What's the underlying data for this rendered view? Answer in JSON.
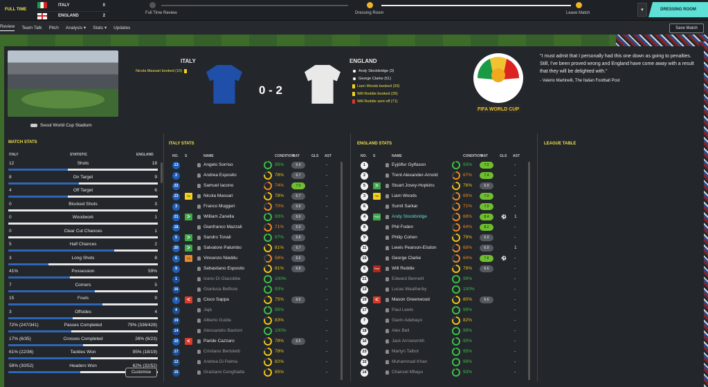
{
  "header": {
    "full_time": "FULL TIME",
    "home": {
      "name": "ITALY",
      "score": "0"
    },
    "away": {
      "name": "ENGLAND",
      "score": "2"
    },
    "timeline": [
      "Full Time Review",
      "Dressing Room",
      "Leave Match"
    ],
    "dressing_room": "DRESSING ROOM",
    "dropdown_icon": "chevron-down-icon"
  },
  "nav": {
    "tabs": [
      "Review",
      "Team Talk",
      "Pitch",
      "Analysis ▾",
      "Stats ▾",
      "Updates"
    ],
    "save": "Save Match"
  },
  "match": {
    "stadium": "Seoul World Cup Stadium",
    "home": "ITALY",
    "away": "ENGLAND",
    "score": "0 - 2",
    "home_events": [
      {
        "text": "Nicola Massari booked (10)",
        "icon": "yellow-card"
      }
    ],
    "away_events": [
      {
        "text": "Andy Stockbridge (3)",
        "icon": "ball"
      },
      {
        "text": "George Clarke (51)",
        "icon": "ball"
      },
      {
        "text": "Liam Woods booked (20)",
        "icon": "yellow-card"
      },
      {
        "text": "Will Reddie booked (26)",
        "icon": "yellow-card"
      },
      {
        "text": "Will Reddie sent off (71)",
        "icon": "red-card"
      }
    ],
    "logo_text": "FIFA WORLD CUP",
    "quote": "\"I must admit that I personally had this one down as going to penalties. Still, I've been proved wrong and England have come away with a result that they will be delighted with.\"",
    "quote_author": "- Valerio Martinelli, The Italian Football Post"
  },
  "colors": {
    "home_shirt": "#1f4fa8",
    "away_shirt": "#eeeeee",
    "accent": "#f0e04a",
    "teal": "#5fe0d6"
  },
  "match_stats": {
    "title": "MATCH STATS",
    "headers": [
      "ITALY",
      "STATISTIC",
      "ENGLAND"
    ],
    "rows": [
      {
        "l": "12",
        "s": "Shots",
        "r": "18",
        "share": 0.4
      },
      {
        "l": "8",
        "s": "On Target",
        "r": "9",
        "share": 0.47
      },
      {
        "l": "4",
        "s": "Off Target",
        "r": "6",
        "share": 0.4
      },
      {
        "l": "0",
        "s": "Blocked Shots",
        "r": "3",
        "share": 0.0
      },
      {
        "l": "0",
        "s": "Woodwork",
        "r": "1",
        "share": 0.0
      },
      {
        "l": "0",
        "s": "Clear Cut Chances",
        "r": "1",
        "share": 0.0
      },
      {
        "l": "5",
        "s": "Half Chances",
        "r": "2",
        "share": 0.71
      },
      {
        "l": "3",
        "s": "Long Shots",
        "r": "8",
        "share": 0.27
      },
      {
        "l": "41%",
        "s": "Possession",
        "r": "59%",
        "share": 0.41
      },
      {
        "l": "7",
        "s": "Corners",
        "r": "5",
        "share": 0.58
      },
      {
        "l": "15",
        "s": "Fouls",
        "r": "9",
        "share": 0.63
      },
      {
        "l": "3",
        "s": "Offsides",
        "r": "4",
        "share": 0.43
      },
      {
        "l": "72% (247/341)",
        "s": "Passes Completed",
        "r": "79% (336/428)",
        "share": 0.42
      },
      {
        "l": "17% (6/35)",
        "s": "Crosses Completed",
        "r": "26% (6/23)",
        "share": 0.5
      },
      {
        "l": "61% (22/36)",
        "s": "Tackles Won",
        "r": "95% (18/19)",
        "share": 0.55
      },
      {
        "l": "58% (30/52)",
        "s": "Headers Won",
        "r": "62% (32/52)",
        "share": 0.48
      }
    ],
    "customise": "Customise"
  },
  "player_headers": [
    "NO.",
    "S",
    "NAME",
    "CONDITION",
    "RAT",
    "GLS",
    "AST"
  ],
  "italy": {
    "title": "ITALY STATS",
    "players": [
      {
        "no": "13",
        "s": "",
        "name": "Angelo Sorriso",
        "cond": "95%",
        "rat": "6.9",
        "gls": "",
        "ast": "-",
        "pct": 95
      },
      {
        "no": "2",
        "s": "",
        "name": "Andrea Esposito",
        "cond": "78%",
        "rat": "6.7",
        "gls": "",
        "ast": "-",
        "pct": 78
      },
      {
        "no": "22",
        "s": "",
        "name": "Samuel Iacono",
        "cond": "74%",
        "rat": "7.0",
        "gls": "",
        "ast": "-",
        "pct": 74
      },
      {
        "no": "23",
        "s": "Yel",
        "name": "Nicola Massari",
        "cond": "78%",
        "rat": "6.7",
        "gls": "",
        "ast": "-",
        "pct": 78
      },
      {
        "no": "3",
        "s": "",
        "name": "Franco Muggeri",
        "cond": "70%",
        "rat": "6.8",
        "gls": "",
        "ast": "-",
        "pct": 70
      },
      {
        "no": "21",
        "s": "in",
        "name": "William Zanella",
        "cond": "93%",
        "rat": "6.6",
        "gls": "",
        "ast": "-",
        "pct": 93
      },
      {
        "no": "18",
        "s": "",
        "name": "Gianfranco Mazzali",
        "cond": "71%",
        "rat": "6.9",
        "gls": "",
        "ast": "-",
        "pct": 71
      },
      {
        "no": "5",
        "s": "in",
        "name": "Sandro Tonali",
        "cond": "97%",
        "rat": "6.8",
        "gls": "",
        "ast": "-",
        "pct": 97
      },
      {
        "no": "20",
        "s": "in",
        "name": "Salvatore Palumbo",
        "cond": "81%",
        "rat": "6.7",
        "gls": "",
        "ast": "-",
        "pct": 81
      },
      {
        "no": "6",
        "s": "Inj",
        "name": "Vincenzo Nieddu",
        "cond": "58%",
        "rat": "6.5",
        "gls": "",
        "ast": "-",
        "pct": 58
      },
      {
        "no": "9",
        "s": "",
        "name": "Sebastiano Esposito",
        "cond": "81%",
        "rat": "6.8",
        "gls": "",
        "ast": "-",
        "pct": 81
      },
      {
        "no": "1",
        "s": "",
        "name": "Ivano Di Giacobbe",
        "cond": "100%",
        "rat": "",
        "gls": "",
        "ast": "-",
        "pct": 100
      },
      {
        "no": "16",
        "s": "",
        "name": "Gianluca Belfiore",
        "cond": "93%",
        "rat": "",
        "gls": "",
        "ast": "-",
        "pct": 93
      },
      {
        "no": "7",
        "s": "out",
        "name": "Cisco Sappa",
        "cond": "75%",
        "rat": "6.6",
        "gls": "",
        "ast": "-",
        "pct": 75
      },
      {
        "no": "4",
        "s": "",
        "name": "Jajá",
        "cond": "95%",
        "rat": "",
        "gls": "",
        "ast": "-",
        "pct": 95
      },
      {
        "no": "19",
        "s": "",
        "name": "Alberto Guida",
        "cond": "83%",
        "rat": "",
        "gls": "",
        "ast": "-",
        "pct": 83
      },
      {
        "no": "14",
        "s": "",
        "name": "Alessandro Bastoni",
        "cond": "100%",
        "rat": "",
        "gls": "",
        "ast": "-",
        "pct": 100
      },
      {
        "no": "10",
        "s": "out",
        "name": "Paride Cazzaro",
        "cond": "78%",
        "rat": "6.5",
        "gls": "",
        "ast": "-",
        "pct": 78
      },
      {
        "no": "17",
        "s": "",
        "name": "Cristiano Bertoletti",
        "cond": "78%",
        "rat": "",
        "gls": "",
        "ast": "-",
        "pct": 78
      },
      {
        "no": "12",
        "s": "",
        "name": "Andrea Di Palma",
        "cond": "82%",
        "rat": "",
        "gls": "",
        "ast": "-",
        "pct": 82
      },
      {
        "no": "15",
        "s": "",
        "name": "Graziano Cenghialta",
        "cond": "85%",
        "rat": "",
        "gls": "",
        "ast": "-",
        "pct": 85
      }
    ]
  },
  "england": {
    "title": "ENGLAND STATS",
    "players": [
      {
        "no": "1",
        "s": "",
        "name": "Eyjólfur Gylfason",
        "cond": "93%",
        "rat": "7.0",
        "gls": "",
        "ast": "-",
        "pct": 93
      },
      {
        "no": "2",
        "s": "",
        "name": "Trent Alexander-Arnold",
        "cond": "67%",
        "rat": "7.4",
        "gls": "",
        "ast": "-",
        "pct": 67
      },
      {
        "no": "5",
        "s": "in",
        "name": "Stuart Josey-Hopkins",
        "cond": "76%",
        "rat": "6.9",
        "gls": "",
        "ast": "-",
        "pct": 76
      },
      {
        "no": "3",
        "s": "Yel",
        "name": "Liam Woods",
        "cond": "69%",
        "rat": "7.0",
        "gls": "",
        "ast": "-",
        "pct": 69
      },
      {
        "no": "6",
        "s": "",
        "name": "Sumit Sarkar",
        "cond": "71%",
        "rat": "7.0",
        "gls": "",
        "ast": "-",
        "pct": 71
      },
      {
        "no": "4",
        "s": "PoM",
        "name": "Andy Stockbridge",
        "cond": "68%",
        "rat": "8.4",
        "gls": "⚽",
        "ast": "1",
        "pct": 68
      },
      {
        "no": "8",
        "s": "",
        "name": "Phil Foden",
        "cond": "64%",
        "rat": "8.2",
        "gls": "",
        "ast": "-",
        "pct": 64
      },
      {
        "no": "9",
        "s": "",
        "name": "Philip Cohen",
        "cond": "79%",
        "rat": "6.9",
        "gls": "",
        "ast": "-",
        "pct": 79
      },
      {
        "no": "11",
        "s": "",
        "name": "Lewis Pearson-Elsdon",
        "cond": "68%",
        "rat": "6.9",
        "gls": "",
        "ast": "1",
        "pct": 68
      },
      {
        "no": "10",
        "s": "",
        "name": "George Clarke",
        "cond": "64%",
        "rat": "7.6",
        "gls": "⚽",
        "ast": "-",
        "pct": 64
      },
      {
        "no": "6",
        "s": "Red",
        "name": "Will Reddie",
        "cond": "78%",
        "rat": "6.6",
        "gls": "",
        "ast": "-",
        "pct": 78
      },
      {
        "no": "21",
        "s": "",
        "name": "Edward Bennett",
        "cond": "99%",
        "rat": "",
        "gls": "",
        "ast": "-",
        "pct": 99
      },
      {
        "no": "13",
        "s": "",
        "name": "Lucas Weatherby",
        "cond": "100%",
        "rat": "",
        "gls": "",
        "ast": "-",
        "pct": 100
      },
      {
        "no": "19",
        "s": "out",
        "name": "Mason Greenwood",
        "cond": "80%",
        "rat": "6.6",
        "gls": "",
        "ast": "-",
        "pct": 80
      },
      {
        "no": "17",
        "s": "",
        "name": "Paul Lewis",
        "cond": "99%",
        "rat": "",
        "gls": "",
        "ast": "-",
        "pct": 99
      },
      {
        "no": "7",
        "s": "",
        "name": "Gavin Adebayo",
        "cond": "82%",
        "rat": "",
        "gls": "",
        "ast": "-",
        "pct": 82
      },
      {
        "no": "18",
        "s": "",
        "name": "Alex Bell",
        "cond": "99%",
        "rat": "",
        "gls": "",
        "ast": "-",
        "pct": 99
      },
      {
        "no": "16",
        "s": "",
        "name": "Jack Arrowsmith",
        "cond": "90%",
        "rat": "",
        "gls": "",
        "ast": "-",
        "pct": 90
      },
      {
        "no": "23",
        "s": "",
        "name": "Martyn Talbot",
        "cond": "95%",
        "rat": "",
        "gls": "",
        "ast": "-",
        "pct": 95
      },
      {
        "no": "15",
        "s": "",
        "name": "Muhammad Khan",
        "cond": "99%",
        "rat": "",
        "gls": "",
        "ast": "-",
        "pct": 99
      },
      {
        "no": "14",
        "s": "",
        "name": "Chancel Mbayo",
        "cond": "93%",
        "rat": "",
        "gls": "",
        "ast": "-",
        "pct": 93
      }
    ]
  },
  "league_table": {
    "title": "LEAGUE TABLE"
  }
}
